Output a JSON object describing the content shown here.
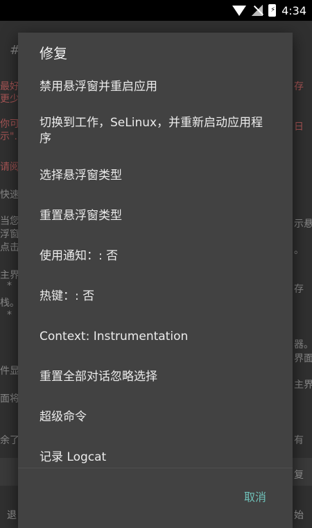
{
  "status": {
    "time": "4:34"
  },
  "dialog": {
    "title": "修复",
    "items": [
      "禁用悬浮窗并重启应用",
      "切换到工作，SeLinux，并重新启动应用程序",
      "选择悬浮窗类型",
      "重置悬浮窗类型",
      "使用通知：: 否",
      "热键：: 否",
      "Context: Instrumentation",
      "重置全部对话忽略选择",
      "超级命令",
      "记录 Logcat"
    ],
    "cancel": "取消"
  },
  "background": {
    "fragments": [
      "#",
      "最好",
      "更少",
      "存",
      "你可",
      "示\".",
      "日",
      "请阅",
      "快速",
      "当您",
      "浮窗",
      "点击",
      "示悬",
      "。",
      "主界",
      "*",
      "存",
      "栈。",
      "*",
      "器。",
      "界面",
      "件显",
      "主界",
      "面将",
      "余了",
      "有",
      "复",
      "退",
      "始"
    ]
  }
}
